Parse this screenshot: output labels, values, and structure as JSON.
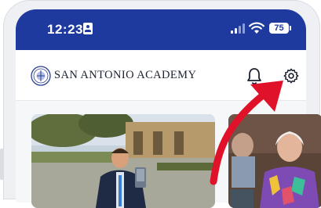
{
  "status_bar": {
    "time": "12:23",
    "battery": "75",
    "icons": [
      "id-card-icon",
      "signal-icon",
      "wifi-icon",
      "battery-icon"
    ]
  },
  "header": {
    "brand_name": "SAN ANTONIO ACADEMY",
    "logo": "school-seal-logo",
    "actions": [
      "bell-icon",
      "gear-icon"
    ]
  },
  "feed": {
    "cards": [
      {
        "image": "man-in-suit-holding-award-photo"
      },
      {
        "image": "woman-in-colorful-top-photo"
      }
    ]
  },
  "colors": {
    "status_bar": "#1f3a9e",
    "annotation_arrow": "#e0122a"
  }
}
